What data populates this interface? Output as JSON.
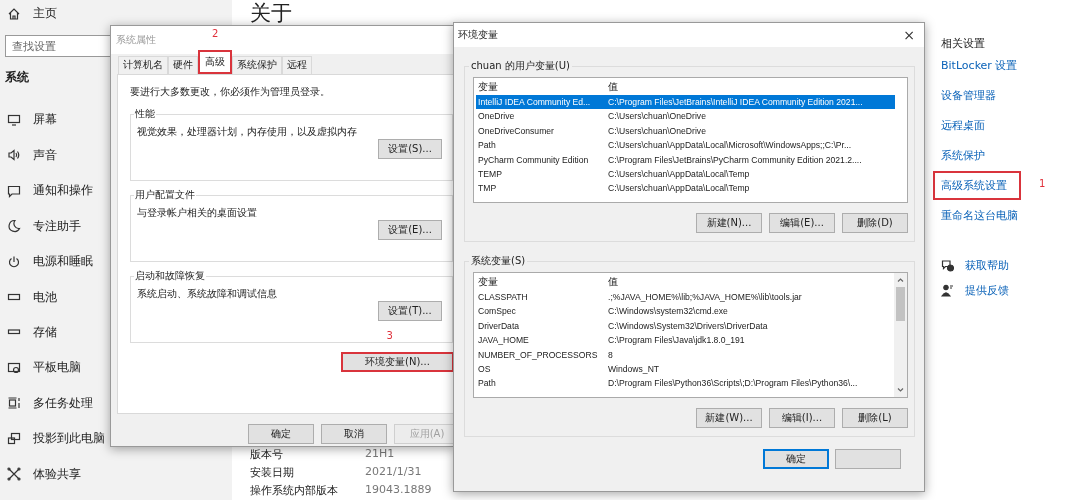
{
  "sidebar": {
    "home": "主页",
    "search": {
      "placeholder": "查找设置"
    },
    "section": "系统",
    "items": [
      {
        "label": "屏幕"
      },
      {
        "label": "声音"
      },
      {
        "label": "通知和操作"
      },
      {
        "label": "专注助手"
      },
      {
        "label": "电源和睡眠"
      },
      {
        "label": "电池"
      },
      {
        "label": "存储"
      },
      {
        "label": "平板电脑"
      },
      {
        "label": "多任务处理"
      },
      {
        "label": "投影到此电脑"
      },
      {
        "label": "体验共享"
      }
    ]
  },
  "main": {
    "title": "关于",
    "specs": [
      {
        "label": "版本号",
        "value": "21H1"
      },
      {
        "label": "安装日期",
        "value": "2021/1/31"
      },
      {
        "label": "操作系统内部版本",
        "value": "19043.1889"
      }
    ]
  },
  "related": {
    "heading": "相关设置",
    "links": [
      {
        "label": "BitLocker 设置",
        "highlighted": false
      },
      {
        "label": "设备管理器",
        "highlighted": false
      },
      {
        "label": "远程桌面",
        "highlighted": false
      },
      {
        "label": "系统保护",
        "highlighted": false
      },
      {
        "label": "高级系统设置",
        "highlighted": true,
        "annotation": "1"
      },
      {
        "label": "重命名这台电脑",
        "highlighted": false
      }
    ],
    "help": [
      {
        "label": "获取帮助"
      },
      {
        "label": "提供反馈"
      }
    ]
  },
  "system_properties": {
    "title": "系统属性",
    "tabs": [
      {
        "label": "计算机名",
        "selected": false,
        "highlighted": false
      },
      {
        "label": "硬件",
        "selected": false,
        "highlighted": false
      },
      {
        "label": "高级",
        "selected": true,
        "highlighted": true,
        "annotation": "2"
      },
      {
        "label": "系统保护",
        "selected": false,
        "highlighted": false
      },
      {
        "label": "远程",
        "selected": false,
        "highlighted": false
      }
    ],
    "notice": "要进行大多数更改，你必须作为管理员登录。",
    "groups": [
      {
        "title": "性能",
        "description": "视觉效果，处理器计划，内存使用，以及虚拟内存",
        "button": "设置(S)..."
      },
      {
        "title": "用户配置文件",
        "description": "与登录帐户相关的桌面设置",
        "button": "设置(E)..."
      },
      {
        "title": "启动和故障恢复",
        "description": "系统启动、系统故障和调试信息",
        "button": "设置(T)..."
      }
    ],
    "env_button": {
      "label": "环境变量(N)...",
      "highlighted": true,
      "annotation": "3"
    },
    "buttons": [
      {
        "label": "确定",
        "disabled": false
      },
      {
        "label": "取消",
        "disabled": false
      },
      {
        "label": "应用(A)",
        "disabled": true
      }
    ]
  },
  "environment_variables": {
    "title": "环境变量",
    "close": "×",
    "user_vars": {
      "title": "chuan 的用户变量(U)",
      "columns": [
        "变量",
        "值"
      ],
      "rows": [
        {
          "name": "IntelliJ IDEA Community Ed...",
          "value": "C:\\Program Files\\JetBrains\\IntelliJ IDEA Community Edition 2021...",
          "selected": true
        },
        {
          "name": "OneDrive",
          "value": "C:\\Users\\chuan\\OneDrive",
          "selected": false
        },
        {
          "name": "OneDriveConsumer",
          "value": "C:\\Users\\chuan\\OneDrive",
          "selected": false
        },
        {
          "name": "Path",
          "value": "C:\\Users\\chuan\\AppData\\Local\\Microsoft\\WindowsApps;;C:\\Pr...",
          "selected": false
        },
        {
          "name": "PyCharm Community Edition",
          "value": "C:\\Program Files\\JetBrains\\PyCharm Community Edition 2021.2....",
          "selected": false
        },
        {
          "name": "TEMP",
          "value": "C:\\Users\\chuan\\AppData\\Local\\Temp",
          "selected": false
        },
        {
          "name": "TMP",
          "value": "C:\\Users\\chuan\\AppData\\Local\\Temp",
          "selected": false
        }
      ],
      "buttons": [
        "新建(N)...",
        "编辑(E)...",
        "删除(D)"
      ]
    },
    "system_vars": {
      "title": "系统变量(S)",
      "columns": [
        "变量",
        "值"
      ],
      "rows": [
        {
          "name": "CLASSPATH",
          "value": ".;%JAVA_HOME%\\lib;%JAVA_HOME%\\lib\\tools.jar",
          "selected": false
        },
        {
          "name": "ComSpec",
          "value": "C:\\Windows\\system32\\cmd.exe",
          "selected": false
        },
        {
          "name": "DriverData",
          "value": "C:\\Windows\\System32\\Drivers\\DriverData",
          "selected": false
        },
        {
          "name": "JAVA_HOME",
          "value": "C:\\Program Files\\Java\\jdk1.8.0_191",
          "selected": false
        },
        {
          "name": "NUMBER_OF_PROCESSORS",
          "value": "8",
          "selected": false
        },
        {
          "name": "OS",
          "value": "Windows_NT",
          "selected": false
        },
        {
          "name": "Path",
          "value": "D:\\Program Files\\Python36\\Scripts\\;D:\\Program Files\\Python36\\...",
          "selected": false
        }
      ],
      "buttons": [
        "新建(W)...",
        "编辑(I)...",
        "删除(L)"
      ]
    },
    "buttons": [
      {
        "label": "确定",
        "default": true
      },
      {
        "default": false
      }
    ]
  }
}
